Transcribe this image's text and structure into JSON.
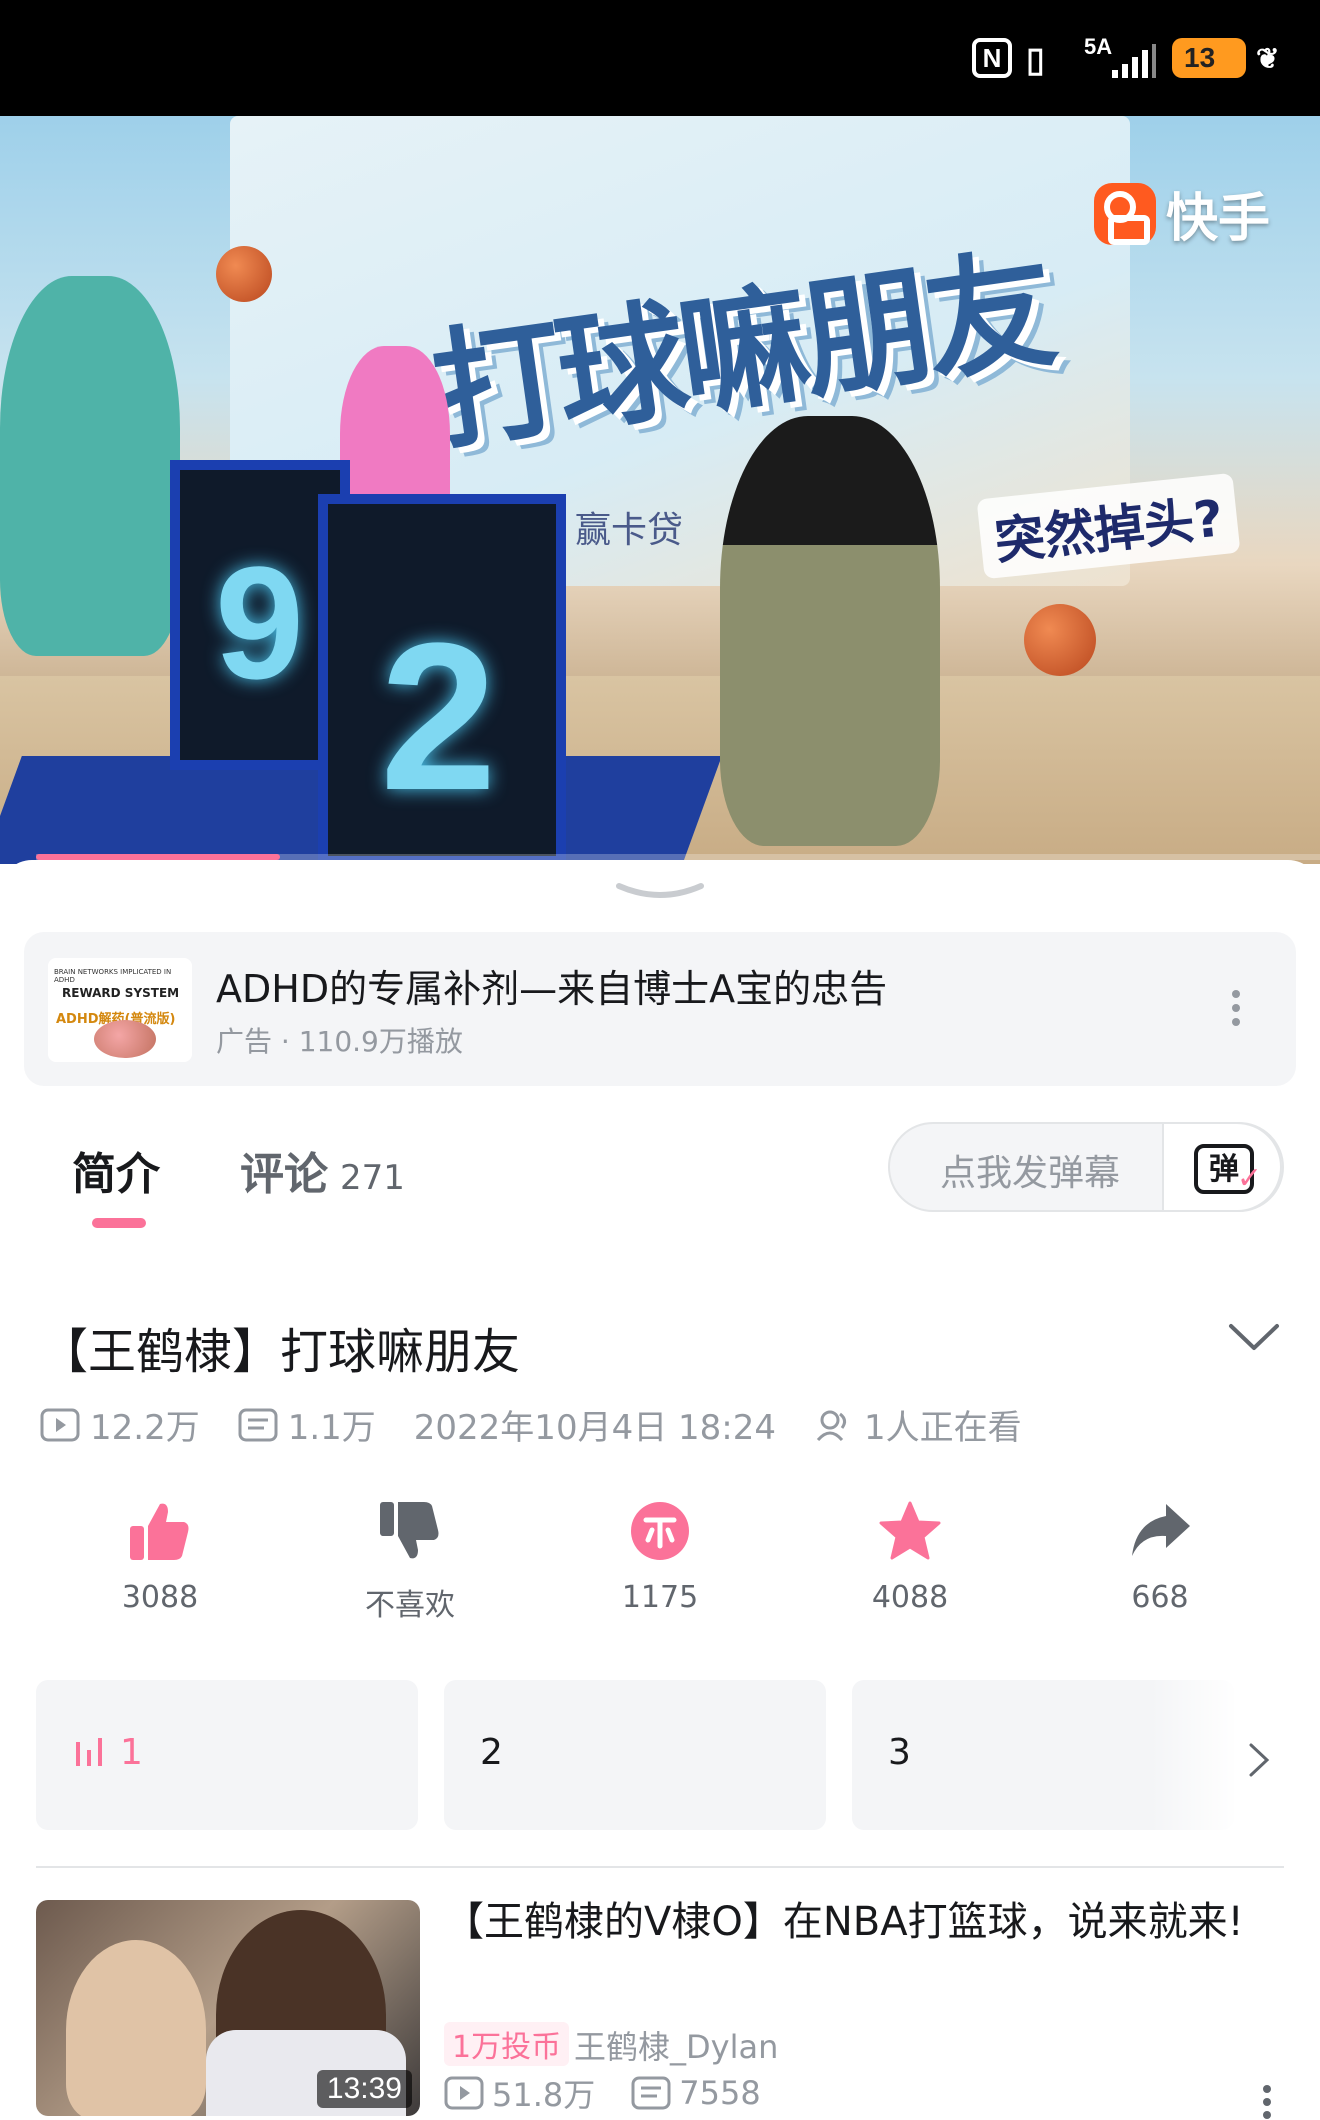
{
  "status_bar": {
    "network": "5A",
    "battery": "13"
  },
  "video": {
    "watermark_app": "快手",
    "banner_text": "赢卡贷",
    "caption": "突然掉头?",
    "score_left": "9",
    "score_right": "2",
    "progress": 0.19
  },
  "ad": {
    "thumb_line1": "BRAIN NETWORKS IMPLICATED IN ADHD",
    "thumb_line2": "REWARD SYSTEM",
    "thumb_line3": "ADHD解药(普流版)",
    "title": "ADHD的专属补剂—来自博士A宝的忠告",
    "subtitle": "广告 · 110.9万播放"
  },
  "tabs": [
    {
      "label": "简介"
    },
    {
      "label": "评论",
      "count": "271"
    }
  ],
  "danmaku": {
    "placeholder": "点我发弹幕",
    "icon_char": "弹"
  },
  "video_info": {
    "title": "【王鹤棣】打球嘛朋友",
    "plays": "12.2万",
    "danmaku_count": "1.1万",
    "datetime": "2022年10月4日 18:24",
    "watching": "1人正在看"
  },
  "actions": [
    {
      "name": "like",
      "label": "3088"
    },
    {
      "name": "dislike",
      "label": "不喜欢"
    },
    {
      "name": "coin",
      "label": "1175"
    },
    {
      "name": "favorite",
      "label": "4088"
    },
    {
      "name": "share",
      "label": "668"
    }
  ],
  "episodes": [
    "1",
    "2",
    "3"
  ],
  "related": {
    "title": "【王鹤棣的V棣O】在NBA打篮球，说来就来!",
    "badge": "1万投币",
    "author": "王鹤棣_Dylan",
    "plays": "51.8万",
    "danmaku": "7558",
    "duration": "13:39"
  },
  "colors": {
    "accent": "#fb7299",
    "text": "#18191c",
    "secondary": "#9499a0"
  }
}
